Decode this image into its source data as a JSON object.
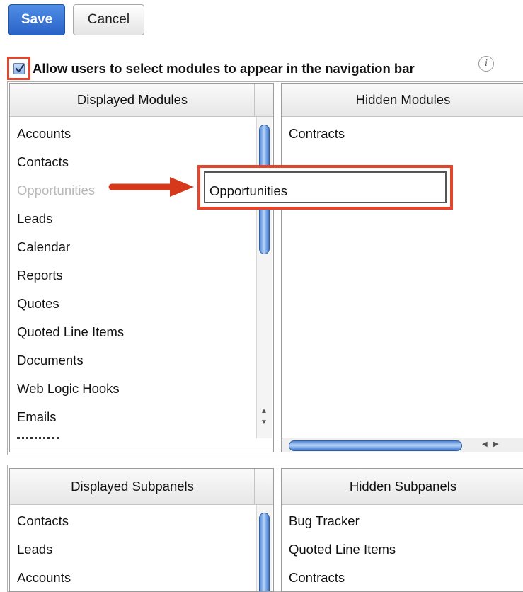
{
  "toolbar": {
    "save_label": "Save",
    "cancel_label": "Cancel"
  },
  "allow_select": {
    "label": "Allow users to select modules to appear in the navigation bar",
    "checked": true,
    "info_glyph": "i",
    "info_icon": "info-icon"
  },
  "modules": {
    "displayed_header": "Displayed Modules",
    "hidden_header": "Hidden Modules",
    "displayed_items": [
      "Accounts",
      "Contacts",
      "Opportunities",
      "Leads",
      "Calendar",
      "Reports",
      "Quotes",
      "Quoted Line Items",
      "Documents",
      "Web Logic Hooks",
      "Emails"
    ],
    "hidden_items": [
      "Contracts"
    ],
    "dragging_item": "Opportunities"
  },
  "subpanels": {
    "displayed_header": "Displayed Subpanels",
    "hidden_header": "Hidden Subpanels",
    "displayed_items": [
      "Contacts",
      "Leads",
      "Accounts"
    ],
    "hidden_items": [
      "Bug Tracker",
      "Quoted Line Items",
      "Contracts"
    ]
  },
  "colors": {
    "highlight": "#e3462c",
    "save_button": "#2a62c7",
    "scroll_thumb": "#6fa0e3"
  }
}
